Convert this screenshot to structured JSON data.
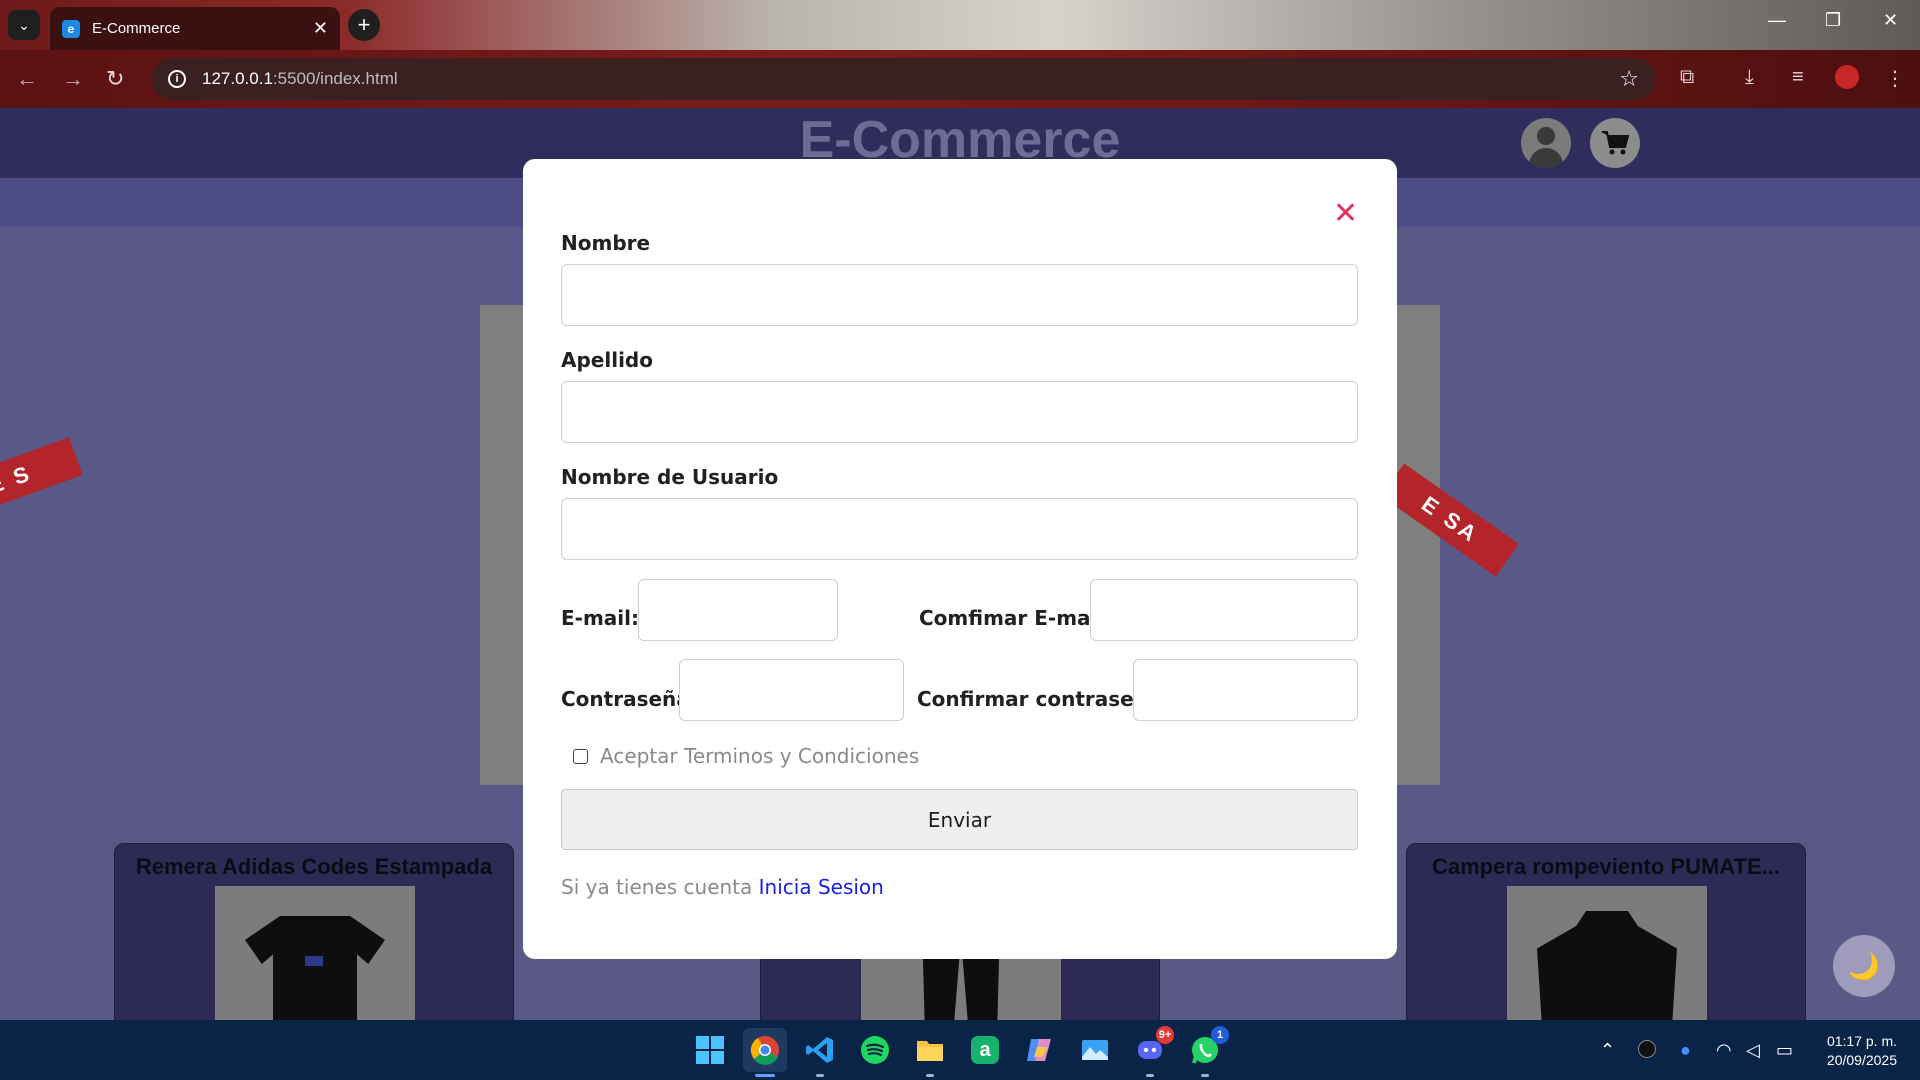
{
  "browser": {
    "tab_title": "E-Commerce",
    "favicon_letter": "e",
    "url_host": "127.0.0.1",
    "url_path": ":5500/index.html"
  },
  "site": {
    "title": "E-Commerce"
  },
  "banner": {
    "ribbon_left": "E S",
    "ribbon_right": "E SA"
  },
  "products": [
    {
      "name": "Remera Adidas Codes Estampada"
    },
    {
      "name": ""
    },
    {
      "name": "Campera rompeviento PUMATE..."
    }
  ],
  "modal": {
    "close_symbol": "✕",
    "fields": {
      "nombre": {
        "label": "Nombre",
        "value": ""
      },
      "apellido": {
        "label": "Apellido",
        "value": ""
      },
      "usuario": {
        "label": "Nombre de Usuario",
        "value": ""
      },
      "email": {
        "label": "E-mail:",
        "value": ""
      },
      "confirm_email": {
        "label": "Comfimar E-mail",
        "value": ""
      },
      "password": {
        "label": "Contraseña",
        "value": ""
      },
      "confirm_password": {
        "label": "Confirmar contraseña",
        "value": ""
      }
    },
    "terms_label": "Aceptar Terminos y Condiciones",
    "terms_checked": false,
    "submit_label": "Enviar",
    "login_prompt": "Si ya tienes cuenta",
    "login_link": "Inicia Sesion"
  },
  "theme_toggle_icon": "🌙",
  "taskbar": {
    "apps": [
      "windows-start",
      "chrome",
      "vscode",
      "spotify",
      "file-explorer",
      "autodesk",
      "copilot",
      "photos",
      "discord",
      "whatsapp"
    ],
    "discord_badge": "9+",
    "whatsapp_badge": "1",
    "time": "01:17 p. m.",
    "date": "20/09/2025"
  },
  "colors": {
    "modal_close": "#e3325d",
    "link": "#1a22e0",
    "header_bg": "#2f2d5b",
    "page_bg": "#5a5887"
  }
}
